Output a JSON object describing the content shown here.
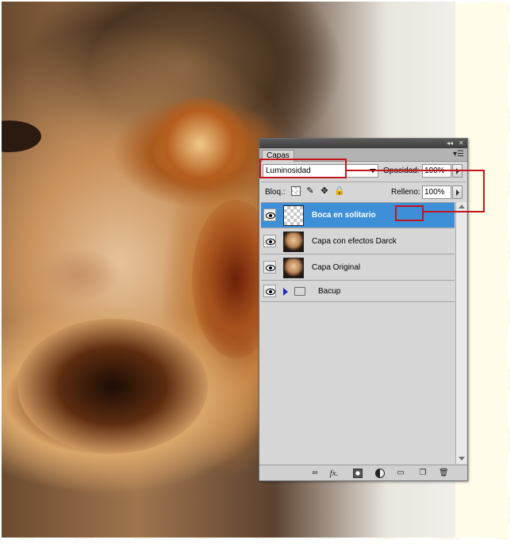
{
  "panel": {
    "tab_label": "Capas",
    "titlebar_collapse": "◂◂",
    "titlebar_close": "✕",
    "menu_icon": "panel-menu-icon",
    "blend_mode": "Luminosidad",
    "opacity_label": "Opacidad:",
    "opacity_value": "100%",
    "lock_label": "Bloq.:",
    "fill_label": "Relleno:",
    "fill_value": "100%",
    "layers": [
      {
        "name": "Boca en solitario",
        "selected": true,
        "thumb": "transparent"
      },
      {
        "name": "Capa con efectos Darck",
        "selected": false,
        "thumb": "face"
      },
      {
        "name": "Capa Original",
        "selected": false,
        "thumb": "face"
      },
      {
        "name": "Bacup",
        "selected": false,
        "type": "group"
      }
    ],
    "bottom_icons": [
      "link-icon",
      "fx-icon",
      "mask-icon",
      "adjustment-icon",
      "folder-icon",
      "new-layer-icon",
      "trash-icon"
    ],
    "fx_label": "fx."
  },
  "colors": {
    "selection": "#3d8fd8",
    "annotation": "#c4141b"
  }
}
